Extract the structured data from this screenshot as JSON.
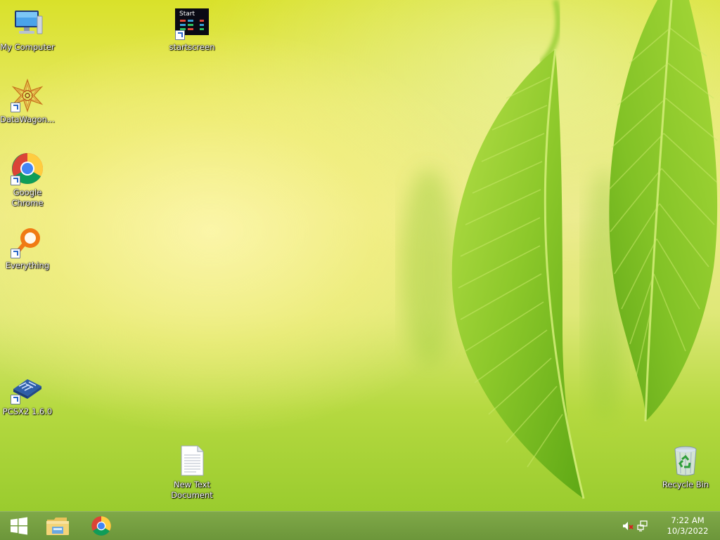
{
  "desktop": {
    "icons": [
      {
        "label": "My Computer"
      },
      {
        "label": "startscreen",
        "tile_text": "Start"
      },
      {
        "label": "DataWagon..."
      },
      {
        "label": "Google Chrome"
      },
      {
        "label": "Everything"
      },
      {
        "label": "PCSX2 1.6.0"
      },
      {
        "label": "New Text Document"
      },
      {
        "label": "Recycle Bin"
      }
    ]
  },
  "taskbar": {
    "start_icon": "windows-logo-icon",
    "pinned": [
      {
        "icon": "file-explorer-icon"
      },
      {
        "icon": "chrome-icon"
      }
    ],
    "tray": {
      "volume_icon": "volume-muted-icon",
      "network_icon": "network-icon",
      "time": "7:22 AM",
      "date": "10/3/2022"
    }
  },
  "colors": {
    "taskbar": "#759f40",
    "label_text": "#ffffff"
  }
}
